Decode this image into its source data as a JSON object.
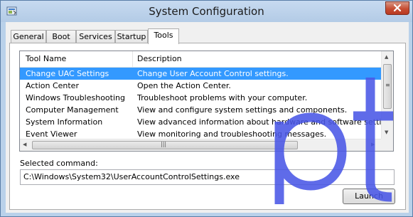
{
  "window": {
    "title": "System Configuration",
    "icon": "msconfig-app-icon",
    "title_bar_color": "#b9d1ea",
    "close_button_color": "#c74d33"
  },
  "tabs": [
    {
      "label": "General",
      "active": false
    },
    {
      "label": "Boot",
      "active": false
    },
    {
      "label": "Services",
      "active": false
    },
    {
      "label": "Startup",
      "active": false
    },
    {
      "label": "Tools",
      "active": true
    }
  ],
  "tools_list": {
    "columns": [
      "Tool Name",
      "Description"
    ],
    "rows": [
      {
        "name": "Change UAC Settings",
        "description": "Change User Account Control settings.",
        "selected": true
      },
      {
        "name": "Action Center",
        "description": "Open the Action Center.",
        "selected": false
      },
      {
        "name": "Windows Troubleshooting",
        "description": "Troubleshoot problems with your computer.",
        "selected": false
      },
      {
        "name": "Computer Management",
        "description": "View and configure system settings and components.",
        "selected": false
      },
      {
        "name": "System Information",
        "description": "View advanced information about hardware and software settings.",
        "selected": false
      },
      {
        "name": "Event Viewer",
        "description": "View monitoring and troubleshooting messages.",
        "selected": false
      }
    ],
    "selection_color": "#3399ff"
  },
  "selected_command": {
    "label": "Selected command:",
    "value": "C:\\Windows\\System32\\UserAccountControlSettings.exe"
  },
  "launch_button": {
    "label": "Launch"
  },
  "watermark": {
    "text": "pt",
    "color": "#4a57e6"
  }
}
